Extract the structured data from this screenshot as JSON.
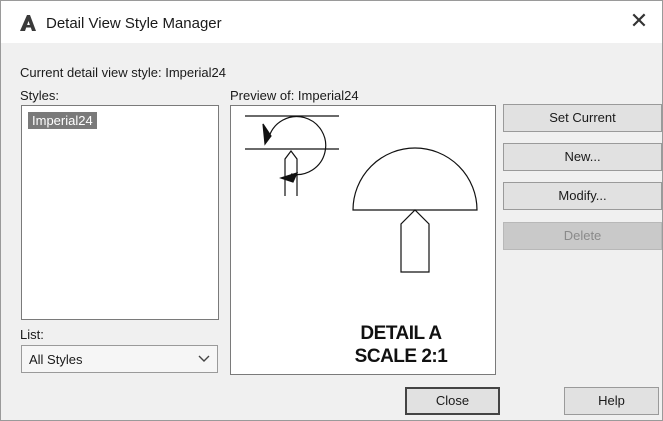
{
  "window": {
    "title": "Detail View Style Manager",
    "close_glyph": "✕"
  },
  "labels": {
    "current_style": "Current detail view style: Imperial24",
    "styles": "Styles:",
    "preview": "Preview of: Imperial24",
    "list": "List:"
  },
  "styles_list": {
    "items": [
      "Imperial24"
    ],
    "selected": "Imperial24"
  },
  "list_filter": {
    "value": "All Styles"
  },
  "preview": {
    "caption_line1": "DETAIL A",
    "caption_line2": "SCALE 2:1"
  },
  "buttons": {
    "set_current": "Set Current",
    "new": "New...",
    "modify": "Modify...",
    "delete": "Delete",
    "close": "Close",
    "help": "Help"
  },
  "icons": {
    "app": "autocad-a-icon",
    "dropdown": "chevron-down-icon"
  }
}
